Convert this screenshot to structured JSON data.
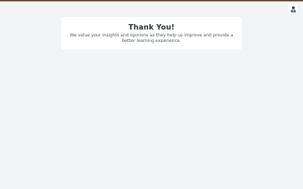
{
  "accent_color": "#6b4a2b",
  "header": {
    "avatar_icon": "user-avatar-icon"
  },
  "card": {
    "title": "Thank You!",
    "message": "We value your insights and opinions as they help us improve and provide a better learning experience."
  }
}
